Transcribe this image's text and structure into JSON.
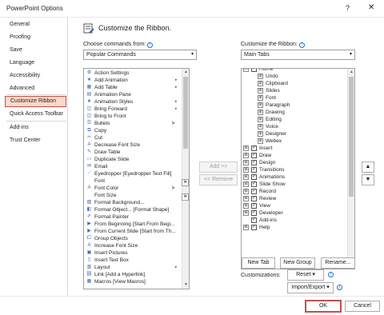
{
  "window": {
    "title": "PowerPoint Options",
    "help": "?",
    "close": "✕"
  },
  "sidebar": {
    "items": [
      {
        "label": "General"
      },
      {
        "label": "Proofing"
      },
      {
        "label": "Save"
      },
      {
        "label": "Language"
      },
      {
        "label": "Accessibility"
      },
      {
        "label": "Advanced"
      },
      {
        "label": "Customize Ribbon"
      },
      {
        "label": "Quick Access Toolbar"
      },
      {
        "label": "Add-ins"
      },
      {
        "label": "Trust Center"
      }
    ],
    "selected": "Customize Ribbon"
  },
  "header": {
    "title": "Customize the Ribbon."
  },
  "left": {
    "label": "Choose commands from:",
    "info": "i",
    "dropdown_value": "Popular Commands",
    "commands": [
      {
        "label": "Action Settings",
        "icon": "action-settings-icon",
        "glyph": "⚙"
      },
      {
        "label": "Add Animation",
        "icon": "star-icon",
        "glyph": "★",
        "submenu": "▸"
      },
      {
        "label": "Add Table",
        "icon": "table-icon",
        "glyph": "▦",
        "submenu": "▸"
      },
      {
        "label": "Animation Pane",
        "icon": "animation-pane-icon",
        "glyph": "▤"
      },
      {
        "label": "Animation Styles",
        "icon": "star-icon",
        "glyph": "★",
        "submenu": "▸"
      },
      {
        "label": "Bring Forward",
        "icon": "bring-forward-icon",
        "glyph": "◫",
        "submenu": "▸"
      },
      {
        "label": "Bring to Front",
        "icon": "bring-front-icon",
        "glyph": "◫"
      },
      {
        "label": "Bullets",
        "icon": "bullets-icon",
        "glyph": "☰",
        "split": "|▸"
      },
      {
        "label": "Copy",
        "icon": "copy-icon",
        "glyph": "⧉"
      },
      {
        "label": "Cut",
        "icon": "scissors-icon",
        "glyph": "✂"
      },
      {
        "label": "Decrease Font Size",
        "icon": "font-size-icon",
        "glyph": "A"
      },
      {
        "label": "Draw Table",
        "icon": "draw-table-icon",
        "glyph": "✎"
      },
      {
        "label": "Duplicate Slide",
        "icon": "duplicate-icon",
        "glyph": "▭"
      },
      {
        "label": "Email",
        "icon": "mail-icon",
        "glyph": "✉"
      },
      {
        "label": "Eyedropper [Eyedropper Text Fill]",
        "icon": "eyedropper-icon",
        "glyph": "⟋"
      },
      {
        "label": "Font",
        "icon": "font-icon",
        "glyph": "",
        "side": "I▾"
      },
      {
        "label": "Font Color",
        "icon": "font-color-icon",
        "glyph": "A",
        "split": "|▸"
      },
      {
        "label": "Font Size",
        "icon": "font-size-icon",
        "glyph": "",
        "side": "I▾"
      },
      {
        "label": "Format Background...",
        "icon": "format-background-icon",
        "glyph": "▨"
      },
      {
        "label": "Format Object... [Format Shape]",
        "icon": "format-shape-icon",
        "glyph": "◧"
      },
      {
        "label": "Format Painter",
        "icon": "format-painter-icon",
        "glyph": "✐"
      },
      {
        "label": "From Beginning [Start From Begi...",
        "icon": "slideshow-icon",
        "glyph": "▶"
      },
      {
        "label": "From Current Slide [Start from Th...",
        "icon": "slideshow-icon",
        "glyph": "▶"
      },
      {
        "label": "Group Objects",
        "icon": "group-icon",
        "glyph": "⧠"
      },
      {
        "label": "Increase Font Size",
        "icon": "font-size-icon",
        "glyph": "A"
      },
      {
        "label": "Insert Pictures",
        "icon": "picture-icon",
        "glyph": "▣"
      },
      {
        "label": "Insert Text Box",
        "icon": "textbox-icon",
        "glyph": "▯"
      },
      {
        "label": "Layout",
        "icon": "layout-icon",
        "glyph": "▥",
        "submenu": "▸"
      },
      {
        "label": "Link [Add a Hyperlink]",
        "icon": "link-icon",
        "glyph": "⛓"
      },
      {
        "label": "Macros [View Macros]",
        "icon": "macros-icon",
        "glyph": "▦"
      }
    ]
  },
  "middle": {
    "add": "Add >>",
    "remove": "<< Remove"
  },
  "right": {
    "label": "Customize the Ribbon:",
    "info": "i",
    "dropdown_value": "Main Tabs",
    "tree": [
      {
        "label": "Home",
        "level": 0,
        "expander": "⊟",
        "checked": true
      },
      {
        "label": "Undo",
        "level": 1,
        "expander": "⊞"
      },
      {
        "label": "Clipboard",
        "level": 1,
        "expander": "⊞"
      },
      {
        "label": "Slides",
        "level": 1,
        "expander": "⊞"
      },
      {
        "label": "Font",
        "level": 1,
        "expander": "⊞"
      },
      {
        "label": "Paragraph",
        "level": 1,
        "expander": "⊞"
      },
      {
        "label": "Drawing",
        "level": 1,
        "expander": "⊞"
      },
      {
        "label": "Editing",
        "level": 1,
        "expander": "⊞"
      },
      {
        "label": "Voice",
        "level": 1,
        "expander": "⊞"
      },
      {
        "label": "Designer",
        "level": 1,
        "expander": "⊞"
      },
      {
        "label": "Webex",
        "level": 1,
        "expander": "⊞"
      },
      {
        "label": "Insert",
        "level": 0,
        "expander": "⊞",
        "checked": true
      },
      {
        "label": "Draw",
        "level": 0,
        "expander": "⊞",
        "checked": true
      },
      {
        "label": "Design",
        "level": 0,
        "expander": "⊞",
        "checked": true
      },
      {
        "label": "Transitions",
        "level": 0,
        "expander": "⊞",
        "checked": true
      },
      {
        "label": "Animations",
        "level": 0,
        "expander": "⊞",
        "checked": true
      },
      {
        "label": "Slide Show",
        "level": 0,
        "expander": "⊞",
        "checked": true
      },
      {
        "label": "Record",
        "level": 0,
        "expander": "⊞",
        "checked": true
      },
      {
        "label": "Review",
        "level": 0,
        "expander": "⊞",
        "checked": true
      },
      {
        "label": "View",
        "level": 0,
        "expander": "⊞",
        "checked": true
      },
      {
        "label": "Developer",
        "level": 0,
        "expander": "⊞",
        "checked": true
      },
      {
        "label": "Add-ins",
        "level": 0,
        "expander": "",
        "checked": true
      },
      {
        "label": "Help",
        "level": 0,
        "expander": "⊞",
        "checked": true
      }
    ],
    "move_up": "▲",
    "move_down": "▼",
    "new_tab": "New Tab",
    "new_group": "New Group",
    "rename": "Rename...",
    "customizations_label": "Customizations:",
    "reset": "Reset ▾",
    "import_export": "Import/Export ▾"
  },
  "footer": {
    "ok": "OK",
    "cancel": "Cancel"
  }
}
